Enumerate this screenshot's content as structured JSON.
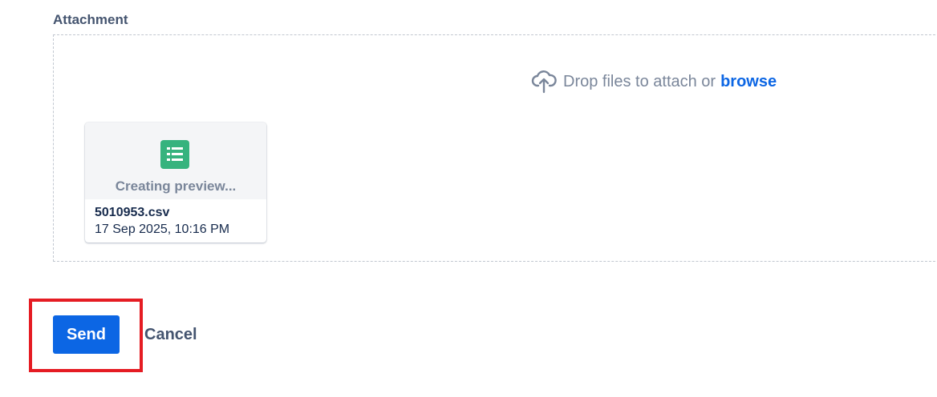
{
  "attachment": {
    "label": "Attachment",
    "drop_hint": "Drop files to attach or",
    "browse_label": "browse",
    "upload_icon": "cloud-upload-icon"
  },
  "file": {
    "icon": "spreadsheet-icon",
    "icon_color": "#36b37e",
    "preview_status": "Creating preview...",
    "name": "5010953.csv",
    "date": "17 Sep 2025, 10:16 PM"
  },
  "actions": {
    "send_label": "Send",
    "cancel_label": "Cancel",
    "accent_color": "#0c66e4",
    "highlight_color": "#e51c23"
  }
}
